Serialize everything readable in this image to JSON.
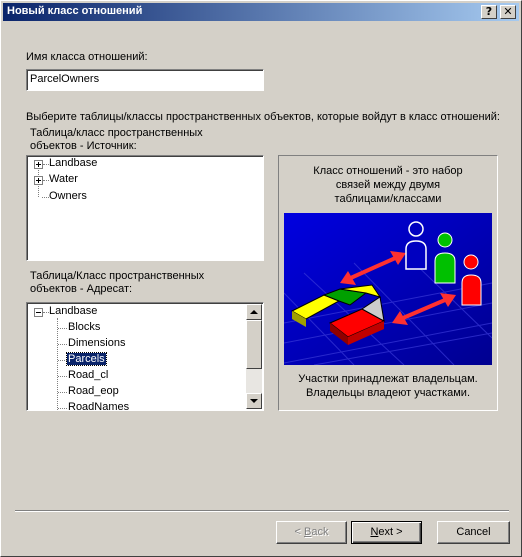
{
  "window": {
    "title": "Новый класс отношений",
    "help_label": "?",
    "close_label": "✕"
  },
  "name_field": {
    "label": "Имя класса отношений:",
    "value": "ParcelOwners"
  },
  "instruction": "Выберите таблицы/классы пространственных объектов, которые войдут в класс отношений:",
  "source": {
    "label_line1": "Таблица/класс пространственных",
    "label_line2": "объектов - Источник:",
    "items": [
      "Landbase",
      "Water",
      "Owners"
    ]
  },
  "destination": {
    "label_line1": "Таблица/Класс пространственных",
    "label_line2": "объектов - Адресат:",
    "root": "Landbase",
    "children": [
      "Blocks",
      "Dimensions",
      "Parcels",
      "Road_cl",
      "Road_eop",
      "RoadNames"
    ],
    "selected": "Parcels"
  },
  "info": {
    "top_line1": "Класс отношений - это набор",
    "top_line2": "связей между двумя",
    "top_line3": "таблицами/классами",
    "bottom_line1": "Участки принадлежат владельцам.",
    "bottom_line2": "Владельцы владеют  участками."
  },
  "buttons": {
    "back_prefix": "< ",
    "back_hotkey": "B",
    "back_rest": "ack",
    "next_hotkey": "N",
    "next_rest": "ext >",
    "cancel": "Cancel"
  },
  "colors": {
    "title_start": "#0a246a",
    "title_end": "#a6caf0",
    "illustration_bg": "#0000c8",
    "selection": "#0a246a"
  }
}
